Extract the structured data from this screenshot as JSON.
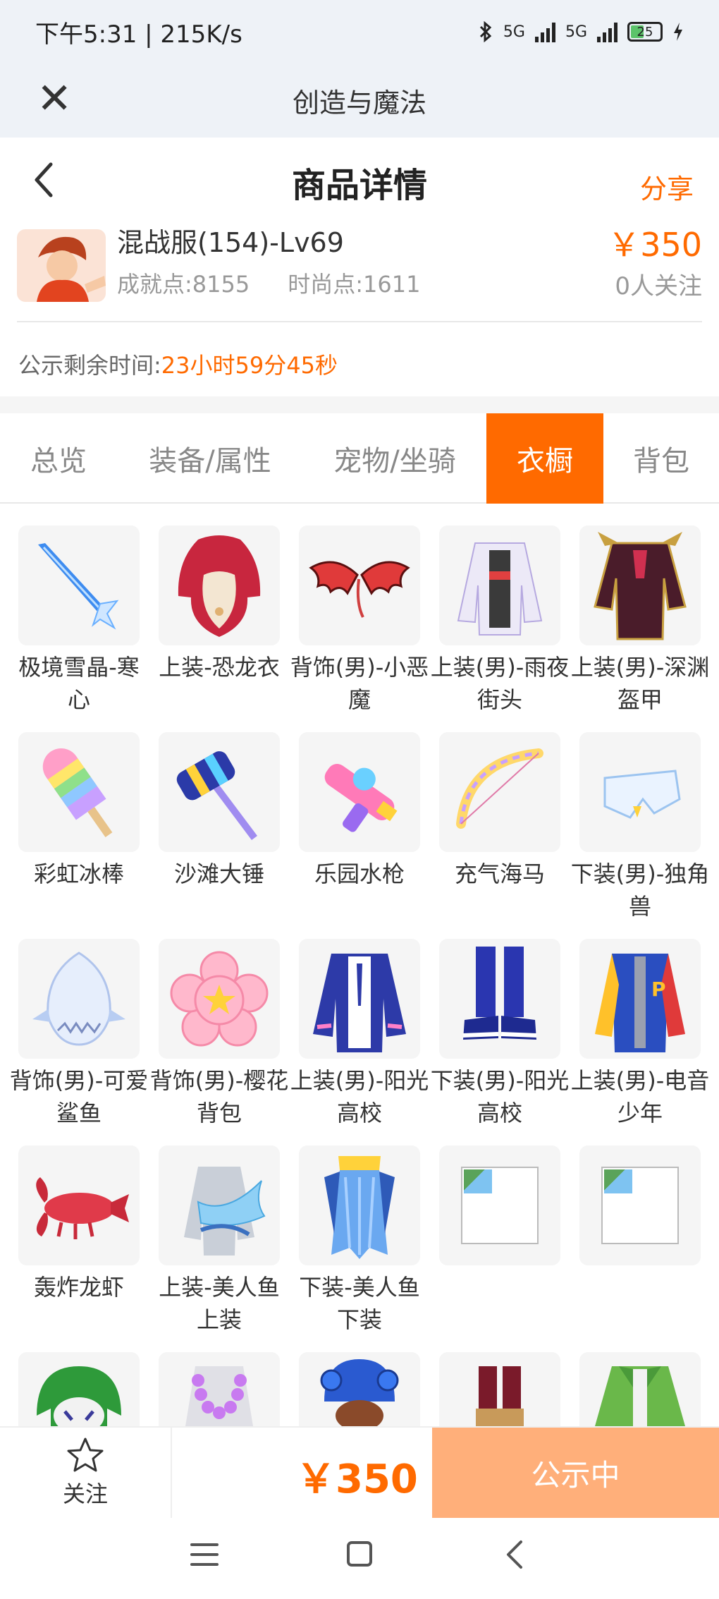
{
  "status_bar": {
    "time_speed": "下午5:31 | 215K/s",
    "network_1": "5G",
    "network_2": "5G",
    "battery": "25"
  },
  "app_bar": {
    "title": "创造与魔法"
  },
  "header": {
    "title": "商品详情",
    "share_label": "分享"
  },
  "product": {
    "name": "混战服(154)-Lv69",
    "achievement": "成就点:8155",
    "fashion": "时尚点:1611",
    "price": "￥350",
    "followers": "0人关注"
  },
  "notice": {
    "label": "公示剩余时间:",
    "time": "23小时59分45秒"
  },
  "tabs": [
    {
      "label": "总览",
      "active": false
    },
    {
      "label": "装备/属性",
      "active": false
    },
    {
      "label": "宠物/坐骑",
      "active": false
    },
    {
      "label": "衣橱",
      "active": true
    },
    {
      "label": "背包",
      "active": false
    }
  ],
  "items": [
    {
      "label": "极境雪晶-寒心",
      "icon": "ice-sword-icon"
    },
    {
      "label": "上装-恐龙衣",
      "icon": "dino-costume-icon"
    },
    {
      "label": "背饰(男)-小恶魔",
      "icon": "devil-wings-icon"
    },
    {
      "label": "上装(男)-雨夜街头",
      "icon": "jacket-icon"
    },
    {
      "label": "上装(男)-深渊盔甲",
      "icon": "armor-icon"
    },
    {
      "label": "彩虹冰棒",
      "icon": "popsicle-icon"
    },
    {
      "label": "沙滩大锤",
      "icon": "hammer-icon"
    },
    {
      "label": "乐园水枪",
      "icon": "water-gun-icon"
    },
    {
      "label": "充气海马",
      "icon": "bow-icon"
    },
    {
      "label": "下装(男)-独角兽",
      "icon": "pants-icon"
    },
    {
      "label": "背饰(男)-可爱鲨鱼",
      "icon": "shark-icon"
    },
    {
      "label": "背饰(男)-樱花背包",
      "icon": "sakura-bag-icon"
    },
    {
      "label": "上装(男)-阳光高校",
      "icon": "school-jacket-icon"
    },
    {
      "label": "下装(男)-阳光高校",
      "icon": "school-pants-icon"
    },
    {
      "label": "上装(男)-电音少年",
      "icon": "varsity-jacket-icon"
    },
    {
      "label": "轰炸龙虾",
      "icon": "lobster-icon"
    },
    {
      "label": "上装-美人鱼上装",
      "icon": "mermaid-top-icon"
    },
    {
      "label": "下装-美人鱼下装",
      "icon": "mermaid-skirt-icon"
    },
    {
      "label": "",
      "icon": "broken-image-icon"
    },
    {
      "label": "",
      "icon": "broken-image-icon"
    },
    {
      "label": "",
      "icon": "clown-hair-icon"
    },
    {
      "label": "",
      "icon": "flower-lei-icon"
    },
    {
      "label": "",
      "icon": "octopus-hat-icon"
    },
    {
      "label": "",
      "icon": "red-pants-icon"
    },
    {
      "label": "",
      "icon": "green-jacket-icon"
    }
  ],
  "bottom": {
    "follow_label": "关注",
    "price": "￥350",
    "status_label": "公示中"
  }
}
